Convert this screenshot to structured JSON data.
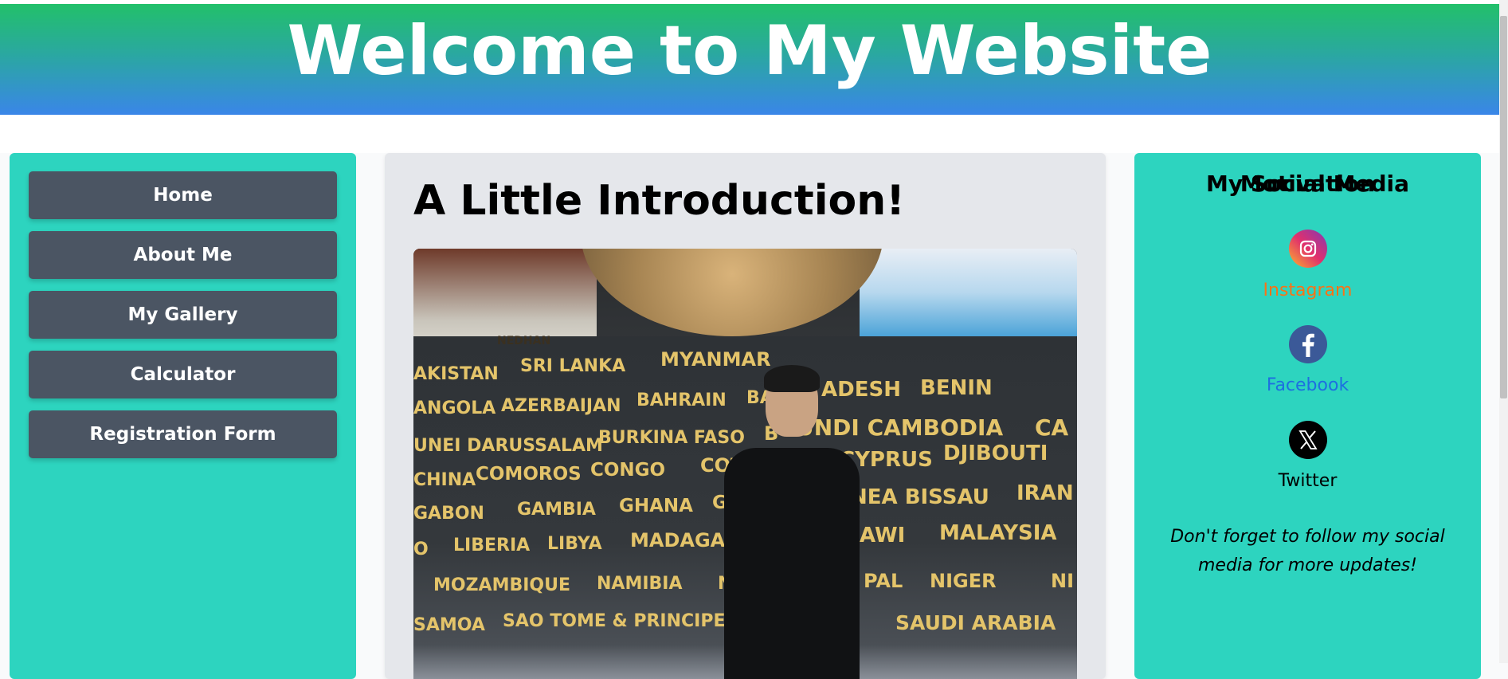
{
  "header": {
    "title": "Welcome to My Website",
    "colors": {
      "top": "#22c06a",
      "bottom": "#3a86e8"
    }
  },
  "nav": {
    "items": [
      {
        "label": "Home"
      },
      {
        "label": "About Me"
      },
      {
        "label": "My Gallery"
      },
      {
        "label": "Calculator"
      },
      {
        "label": "Registration Form"
      }
    ],
    "panel_color": "#2dd4bf",
    "button_color": "#4b5563"
  },
  "main": {
    "title": "A Little Introduction!",
    "photo": {
      "wall_words": [
        "AKISTAN",
        "SRI LANKA",
        "MYANMAR",
        "ANGOLA",
        "AZERBAIJAN",
        "BAHRAIN",
        "BA",
        "ADESH",
        "BENIN",
        "UNEI DARUSSALAM",
        "BURKINA FASO",
        "B",
        "UNDI CAMBODIA",
        "CA",
        "CHINA",
        "COMOROS",
        "CONGO",
        "COTE",
        "CYPRUS",
        "DJIBOUTI",
        "GABON",
        "GAMBIA",
        "GHANA",
        "GU",
        "NEA BISSAU",
        "IRAN",
        "O",
        "LIBERIA",
        "LIBYA",
        "MADAGAS",
        "AWI",
        "MALAYSIA",
        "MOZAMBIQUE",
        "NAMIBIA",
        "NA",
        "PAL",
        "NIGER",
        "NI",
        "SAMOA",
        "SAO TOME & PRINCIPE",
        "SAUDI ARABIA",
        "NEDHAN"
      ]
    }
  },
  "social": {
    "title": "My Social Media",
    "links": [
      {
        "label": "Instagram",
        "icon": "instagram-icon",
        "color": "#f97316"
      },
      {
        "label": "Facebook",
        "icon": "facebook-icon",
        "color": "#1d6fe0"
      },
      {
        "label": "Twitter",
        "icon": "x-twitter-icon",
        "color": "#000000"
      }
    ],
    "note": "Don't forget to follow my social media for more updates!",
    "motivation_title": "Motivation"
  }
}
